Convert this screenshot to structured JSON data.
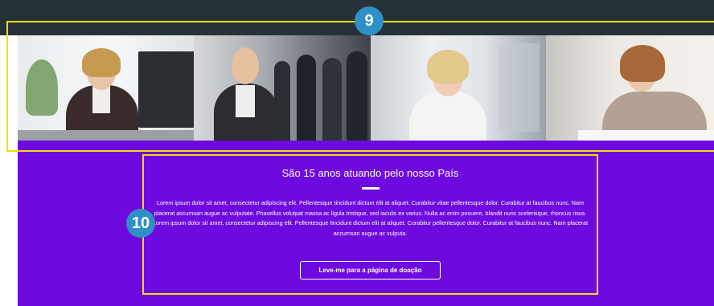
{
  "annotations": {
    "badge_9": "9",
    "badge_10": "10"
  },
  "photos": [
    {
      "icon": "businesswoman-at-desk-photo"
    },
    {
      "icon": "businesswoman-team-photo"
    },
    {
      "icon": "blonde-woman-portrait-photo"
    },
    {
      "icon": "woman-writing-photo"
    }
  ],
  "section": {
    "heading": "São 15 anos atuando pelo nosso País",
    "body": "Lorem ipsum dolor sit amet, consectetur adipiscing elit. Pellentesque tincidunt dictum elit at aliquet. Curabitur vitae pellentesque dolor. Curabitur at faucibus nunc. Nam placerat accumsan augue ac vulputate. Phasellus volutpat massa ac ligula tristique, sed iaculis ex varius. Nulla ac enim posuere, blandit nunc scelerisque, rhoncus risus. Lorem ipsum dolor sit amet, consectetur adipiscing elit. Pellentesque tincidunt dictum elit at aliquet. Curabitur pellentesque dolor. Curabitur at faucibus nunc. Nam placerat accumsan augue ac vulputa.",
    "button_label": "Leve-me para a página de doação"
  },
  "colors": {
    "top_bar": "#263238",
    "accent_purple": "#6e0ae0",
    "annotation_yellow": "#f4dd00",
    "badge_blue": "#2f8fc7"
  }
}
